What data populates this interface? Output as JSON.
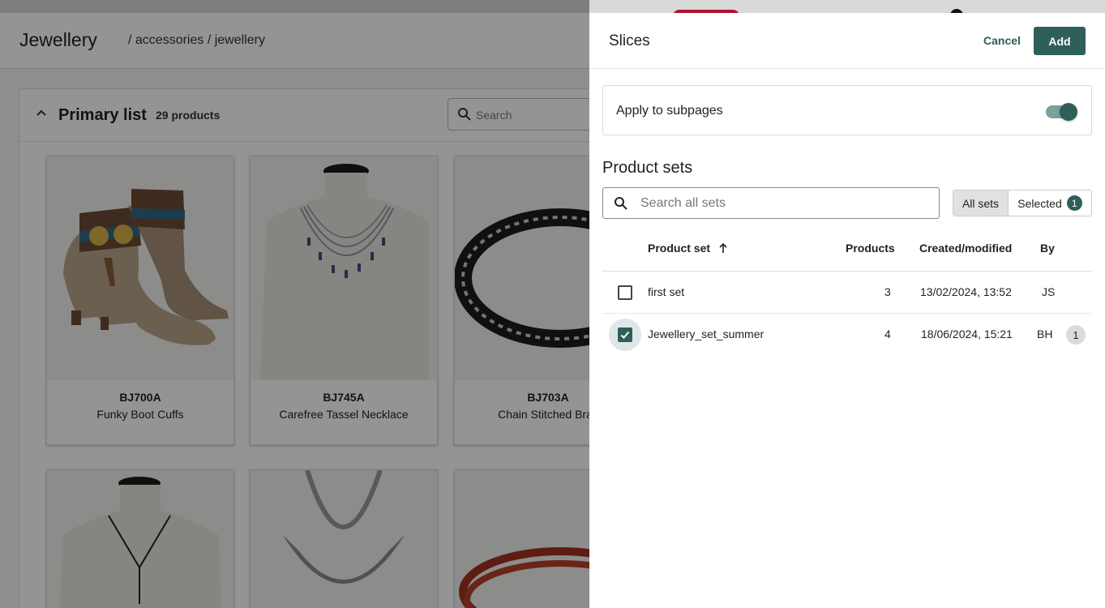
{
  "page": {
    "title": "Jewellery",
    "breadcrumb": "/ accessories / jewellery"
  },
  "list": {
    "title": "Primary list",
    "count": "29 products",
    "search_placeholder": "Search",
    "products": [
      {
        "sku": "BJ700A",
        "name": "Funky Boot Cuffs"
      },
      {
        "sku": "BJ745A",
        "name": "Carefree Tassel Necklace"
      },
      {
        "sku": "BJ703A",
        "name": "Chain Stitched Brac"
      }
    ]
  },
  "drawer": {
    "title": "Slices",
    "cancel_label": "Cancel",
    "add_label": "Add",
    "apply_subpages_label": "Apply to subpages",
    "apply_subpages_on": true,
    "sets_title": "Product sets",
    "search_placeholder": "Search all sets",
    "filter_all": "All sets",
    "filter_selected": "Selected",
    "selected_count": "1",
    "columns": {
      "product_set": "Product set",
      "products": "Products",
      "created": "Created/modified",
      "by": "By"
    },
    "rows": [
      {
        "name": "first set",
        "products": "3",
        "created": "13/02/2024, 13:52",
        "by": "JS",
        "checked": false,
        "badge": ""
      },
      {
        "name": "Jewellery_set_summer",
        "products": "4",
        "created": "18/06/2024, 15:21",
        "by": "BH",
        "checked": true,
        "badge": "1"
      }
    ]
  },
  "colors": {
    "accent": "#2f5f5b",
    "overlay": "rgba(0,0,0,0.42)"
  }
}
